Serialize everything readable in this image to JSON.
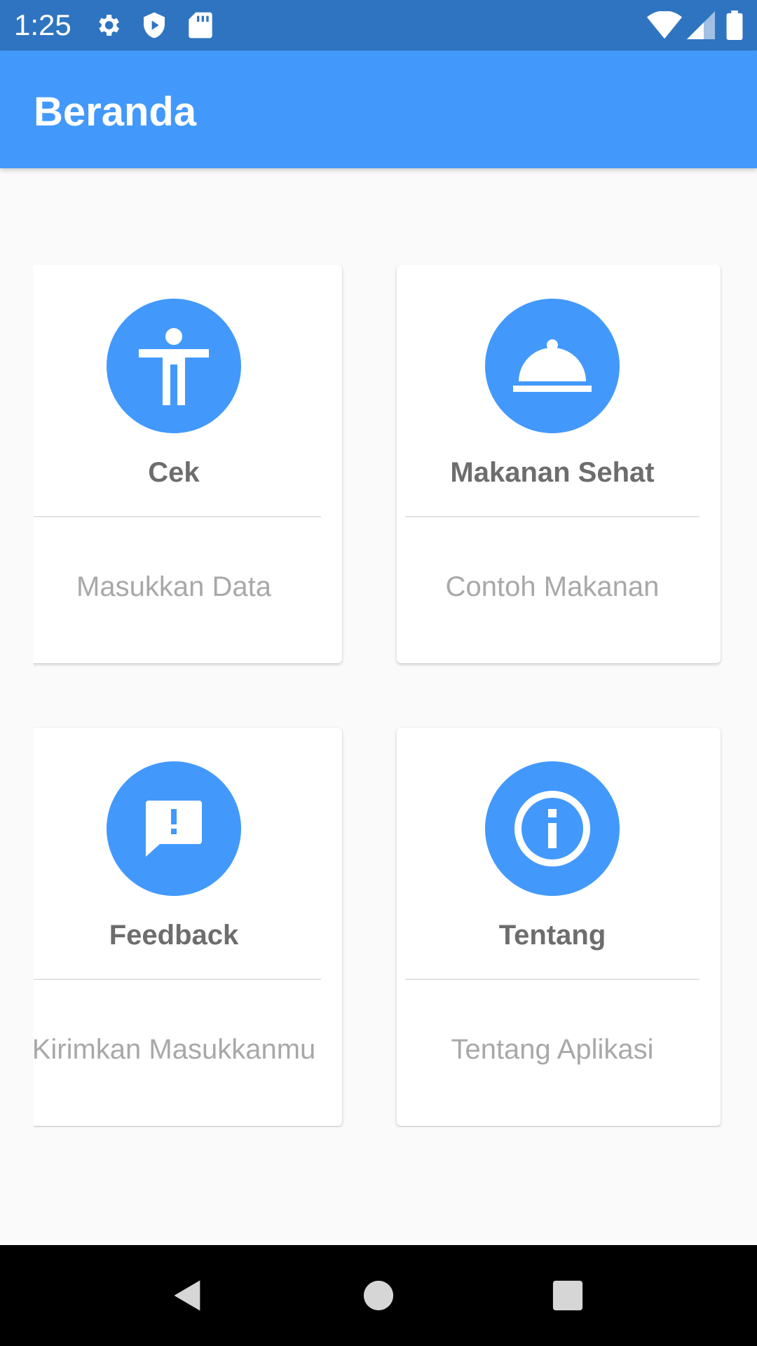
{
  "status_bar": {
    "time": "1:25",
    "icons": [
      "gear-icon",
      "shield-play-icon",
      "sd-card-icon",
      "wifi-icon",
      "signal-icon",
      "battery-icon"
    ]
  },
  "app_bar": {
    "title": "Beranda"
  },
  "menu": [
    {
      "title": "Cek",
      "subtitle": "Masukkan Data",
      "icon": "accessibility-icon"
    },
    {
      "title": "Makanan Sehat",
      "subtitle": "Contoh Makanan",
      "icon": "room-service-icon"
    },
    {
      "title": "Feedback",
      "subtitle": "Kirimkan Masukkanmu",
      "icon": "feedback-icon"
    },
    {
      "title": "Tentang",
      "subtitle": "Tentang Aplikasi",
      "icon": "info-icon"
    }
  ],
  "nav_bar": {
    "buttons": [
      "back-icon",
      "home-icon",
      "recents-icon"
    ]
  },
  "colors": {
    "status_bar": "#2f74c0",
    "app_bar": "#4299fb",
    "accent": "#4299fb",
    "background": "#fafafa"
  }
}
